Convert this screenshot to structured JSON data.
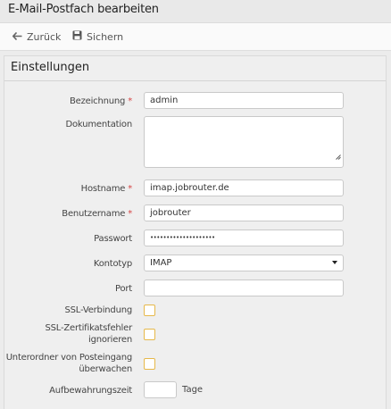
{
  "window": {
    "title": "E-Mail-Postfach bearbeiten"
  },
  "toolbar": {
    "back_label": "Zurück",
    "back_icon": "arrow-left-icon",
    "save_label": "Sichern",
    "save_icon": "floppy-disk-icon"
  },
  "panel": {
    "title": "Einstellungen"
  },
  "form": {
    "required_marker": "*",
    "bezeichnung": {
      "label": "Bezeichnung",
      "value": "admin",
      "required": true
    },
    "dokumentation": {
      "label": "Dokumentation",
      "value": ""
    },
    "hostname": {
      "label": "Hostname",
      "value": "imap.jobrouter.de",
      "required": true
    },
    "benutzername": {
      "label": "Benutzername",
      "value": "jobrouter",
      "required": true
    },
    "passwort": {
      "label": "Passwort",
      "value": "••••••••••••••••••••"
    },
    "kontotyp": {
      "label": "Kontotyp",
      "value": "IMAP"
    },
    "port": {
      "label": "Port",
      "value": ""
    },
    "ssl": {
      "label": "SSL-Verbindung",
      "checked": false
    },
    "ssl_cert_line1": "SSL-Zertifikatsfehler",
    "ssl_cert_line2": "ignorieren",
    "ssl_cert_checked": false,
    "subfolder_line1": "Unterordner von Posteingang",
    "subfolder_line2": "überwachen",
    "subfolder_checked": false,
    "aufbewahrung": {
      "label": "Aufbewahrungszeit",
      "value": "",
      "unit": "Tage"
    }
  },
  "colors": {
    "required": "#d64545",
    "checkbox_border": "#e6b84a",
    "background": "#ececec"
  }
}
